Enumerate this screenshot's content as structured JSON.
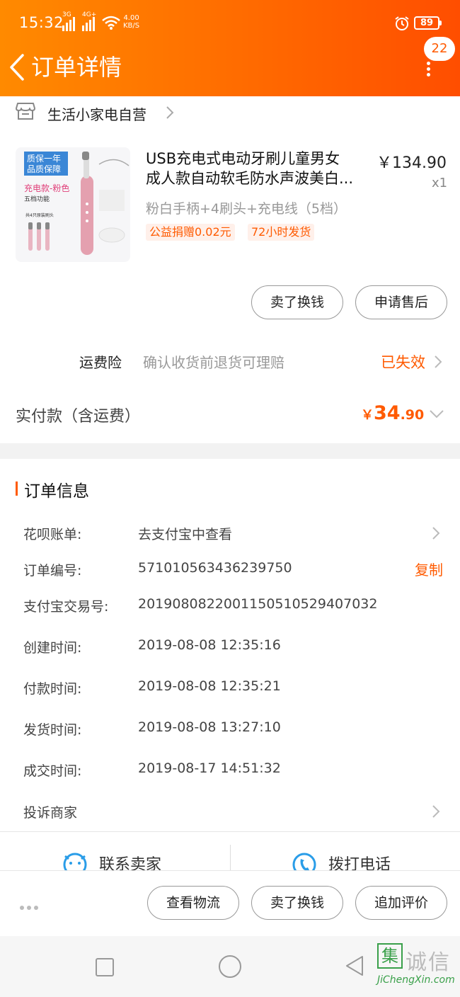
{
  "status_bar": {
    "time": "15:32",
    "net1": "3G",
    "net2": "4G+",
    "speed_value": "4.00",
    "speed_unit": "KB/S",
    "battery": "89"
  },
  "nav": {
    "title": "订单详情",
    "message_count": "22"
  },
  "shop": {
    "name": "生活小家电自营"
  },
  "product": {
    "title_line1": "USB充电式电动牙刷儿童男女",
    "title_line2": "成人款自动软毛防水声波美白...",
    "price": "￥134.90",
    "quantity": "x1",
    "sku": "粉白手柄+4刷头+充电线（5档）",
    "tags": [
      "公益捐赠0.02元",
      "72小时发货"
    ],
    "image": {
      "badge_line1": "质保一年",
      "badge_line2": "品质保障",
      "caption": "充电款-粉色",
      "sub_caption": "五档功能",
      "head_caption": "共4只原装刷头"
    }
  },
  "item_actions": {
    "sell": "卖了换钱",
    "refund": "申请售后"
  },
  "insurance": {
    "label": "运费险",
    "desc": "确认收货前退货可理赔",
    "status": "已失效"
  },
  "payment": {
    "label": "实付款（含运费）",
    "currency": "￥",
    "amount_int": "34",
    "amount_dec": ".90"
  },
  "order_info": {
    "title": "订单信息",
    "rows": [
      {
        "label": "花呗账单:",
        "value": "去支付宝中查看"
      },
      {
        "label": "订单编号:",
        "value": "571010563436239750",
        "action": "复制"
      },
      {
        "label": "支付宝交易号:",
        "value": "2019080822001150510529407032"
      },
      {
        "label": "创建时间:",
        "value": "2019-08-08 12:35:16"
      },
      {
        "label": "付款时间:",
        "value": "2019-08-08 12:35:21"
      },
      {
        "label": "发货时间:",
        "value": "2019-08-08 13:27:10"
      },
      {
        "label": "成交时间:",
        "value": "2019-08-17 14:51:32"
      },
      {
        "label": "投诉商家",
        "value": ""
      }
    ]
  },
  "contact": {
    "seller": "联系卖家",
    "phone": "拨打电话"
  },
  "bottom_actions": {
    "logistics": "查看物流",
    "sell": "卖了换钱",
    "review": "追加评价"
  },
  "watermark": {
    "box_char": "集",
    "text": "诚信",
    "domain": "JiChengXin.com"
  },
  "colors": {
    "accent": "#ff5a00",
    "header_start": "#ff8a00",
    "header_end": "#ff4e00"
  }
}
